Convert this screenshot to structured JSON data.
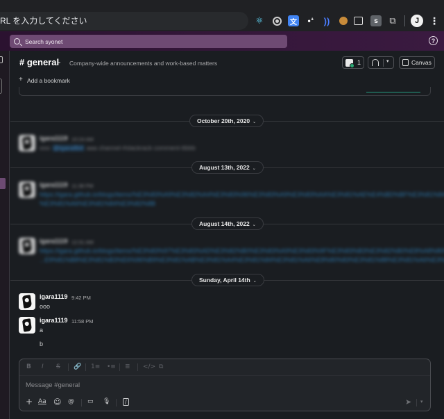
{
  "browser": {
    "address_text": "RL を入力してください",
    "extensions": [
      "react-icon",
      "target-icon",
      "translate-icon",
      "dots-icon",
      "wave-icon",
      "cookie-icon",
      "screenshot-icon",
      "s-extension-icon",
      "puzzle-icon"
    ],
    "translate_glyph": "文",
    "s_glyph": "s",
    "profile_initial": "J",
    "menu_glyph": "⋮"
  },
  "slack": {
    "search_placeholder": "Search syonet",
    "help_glyph": "?",
    "channel": {
      "name": "# general",
      "topic": "Company-wide announcements and work-based matters",
      "member_count": "1",
      "canvas_label": "Canvas",
      "bookmark_label": "Add a bookmark"
    },
    "date_separators": [
      "October 20th, 2020",
      "August 13th, 2022",
      "August 14th, 2022",
      "Sunday, April 14th"
    ],
    "messages": [
      {
        "user": "igara1119",
        "time": "10:24 AM",
        "line1_a": "ooo",
        "line1_mention": "@igara8bit",
        "line1_b": "aaa channel-#slackrack comment-ttbbb",
        "blurred": true
      },
      {
        "user": "igara1119",
        "time": "11:38 PM",
        "line1": "https://igara.github.io/blogs/items/%E3%83%A9%E3%82%A4%E3%83%96%E3%83%A9%E3%83%AA%E3%81%AE%E4%BD%BF%E3%81%84%E6%96%B9%E3%81%AB%E3%81%A4%E3%81%84%E3%81%A6",
        "line2": "%E3%81%A6%E3%81%84%E3%82%8B",
        "blurred": true
      },
      {
        "user": "igara1119",
        "time": "12:31 AM",
        "line1": "https://igara.github.io/blogs/items/%E3%83%97%E3%83%AD%E3%82%B0%E3%83%A9%E3%83%9F%E3%83%B3%E3%82%B0%E8%A8%80%E8%AA%9E%E3%81%AE",
        "line2": "...E9%81%B8%E3%81%B3%E6%96%B9%E3%81%AB%E3%81%A4%E3%81%84%E3%81%A6%E8%80%83%E3%81%88%E3%81%A6%E3%81%BF%E3%81%9F",
        "blurred": true
      },
      {
        "user": "igara1119",
        "time": "9:42 PM",
        "line1": "ooo",
        "blurred": false
      },
      {
        "user": "igara1119",
        "time": "11:58 PM",
        "line1": "a",
        "line2": "b",
        "blurred": false
      }
    ],
    "composer": {
      "placeholder": "Message #general",
      "format_buttons": [
        "B",
        "I",
        "S",
        "🔗",
        "1≡",
        "•≡",
        "≣",
        "</>",
        "⧉"
      ],
      "action_buttons": [
        "+",
        "Aa",
        "☺",
        "@",
        "▭",
        "🎙",
        "/"
      ]
    }
  },
  "colors": {
    "workspace_bar": "#36173b",
    "search_bg": "#6e4a73",
    "app_bg": "#1a1d21",
    "link": "#2f8fd1"
  }
}
